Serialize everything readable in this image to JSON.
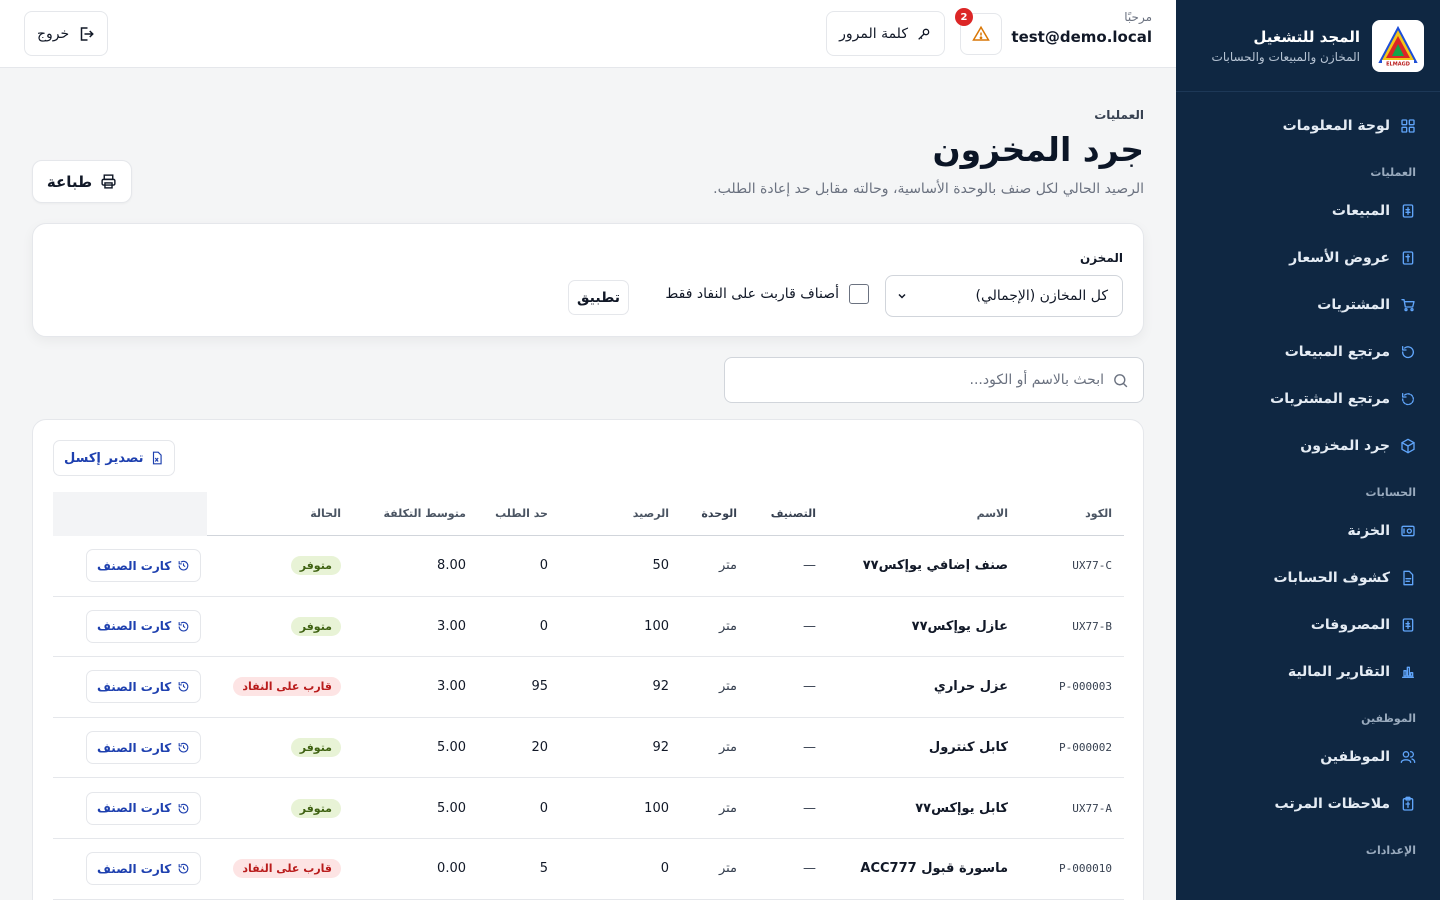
{
  "brand": {
    "title": "المجد للتشغيل",
    "subtitle": "المخازن والمبيعات والحسابات",
    "logo_text": "ELMAGD"
  },
  "sidebar": {
    "items": [
      {
        "label": "لوحة المعلومات",
        "icon": "dashboard-icon"
      },
      {
        "section": "العمليات"
      },
      {
        "label": "المبيعات",
        "icon": "invoice-icon"
      },
      {
        "label": "عروض الأسعار",
        "icon": "quote-icon"
      },
      {
        "label": "المشتريات",
        "icon": "cart-icon"
      },
      {
        "label": "مرتجع المبيعات",
        "icon": "return-icon"
      },
      {
        "label": "مرتجع المشتريات",
        "icon": "return-dashed-icon"
      },
      {
        "label": "جرد المخزون",
        "icon": "box-icon"
      },
      {
        "section": "الحسابات"
      },
      {
        "label": "الخزنة",
        "icon": "safe-icon"
      },
      {
        "label": "كشوف الحسابات",
        "icon": "file-icon"
      },
      {
        "label": "المصروفات",
        "icon": "receipt-icon"
      },
      {
        "label": "التقارير المالية",
        "icon": "bar-chart-icon"
      },
      {
        "section": "الموظفين"
      },
      {
        "label": "الموظفين",
        "icon": "users-icon"
      },
      {
        "label": "ملاحظات المرتب",
        "icon": "clipboard-icon"
      },
      {
        "section": "الإعدادات"
      }
    ]
  },
  "topbar": {
    "hello": "مرحبًا",
    "email": "test@demo.local",
    "alert_count": "2",
    "password_label": "كلمة المرور",
    "logout_label": "خروج"
  },
  "page": {
    "breadcrumb": "العمليات",
    "title": "جرد المخزون",
    "subtitle": "الرصيد الحالي لكل صنف بالوحدة الأساسية، وحالته مقابل حد إعادة الطلب.",
    "print_label": "طباعة"
  },
  "filter": {
    "warehouse_label": "المخزن",
    "warehouse_value": "كل المخازن (الإجمالي)",
    "low_only_label": "أصناف قاربت على النفاد فقط",
    "apply_label": "تطبيق"
  },
  "search": {
    "placeholder": "ابحث بالاسم أو الكود..."
  },
  "table": {
    "export_label": "تصدير إكسل",
    "columns": {
      "code": "الكود",
      "name": "الاسم",
      "category": "التصنيف",
      "unit": "الوحدة",
      "balance": "الرصيد",
      "reorder": "حد الطلب",
      "avg_cost": "متوسط التكلفة",
      "status": "الحالة"
    },
    "action_label": "كارت الصنف",
    "rows": [
      {
        "code": "UX77-C",
        "name": "صنف إضافي يوإكس٧٧",
        "category": "—",
        "unit": "متر",
        "balance": "50",
        "reorder": "0",
        "avg_cost": "8.00",
        "status": "متوفر",
        "status_type": "ok"
      },
      {
        "code": "UX77-B",
        "name": "عازل يوإكس٧٧",
        "category": "—",
        "unit": "متر",
        "balance": "100",
        "reorder": "0",
        "avg_cost": "3.00",
        "status": "متوفر",
        "status_type": "ok"
      },
      {
        "code": "P-000003",
        "name": "عزل حراري",
        "category": "—",
        "unit": "متر",
        "balance": "92",
        "reorder": "95",
        "avg_cost": "3.00",
        "status": "قارب على النفاد",
        "status_type": "low"
      },
      {
        "code": "P-000002",
        "name": "كابل كنترول",
        "category": "—",
        "unit": "متر",
        "balance": "92",
        "reorder": "20",
        "avg_cost": "5.00",
        "status": "متوفر",
        "status_type": "ok"
      },
      {
        "code": "UX77-A",
        "name": "كابل يوإكس٧٧",
        "category": "—",
        "unit": "متر",
        "balance": "100",
        "reorder": "0",
        "avg_cost": "5.00",
        "status": "متوفر",
        "status_type": "ok"
      },
      {
        "code": "P-000010",
        "name": "ماسورة قبول ACC777",
        "category": "—",
        "unit": "متر",
        "balance": "0",
        "reorder": "5",
        "avg_cost": "0.00",
        "status": "قارب على النفاد",
        "status_type": "low"
      }
    ]
  },
  "colors": {
    "sidebar_bg": "#0f2742",
    "accent": "#1e40af",
    "ok_bg": "#e8f3d6",
    "low_bg": "#fde4e4"
  }
}
